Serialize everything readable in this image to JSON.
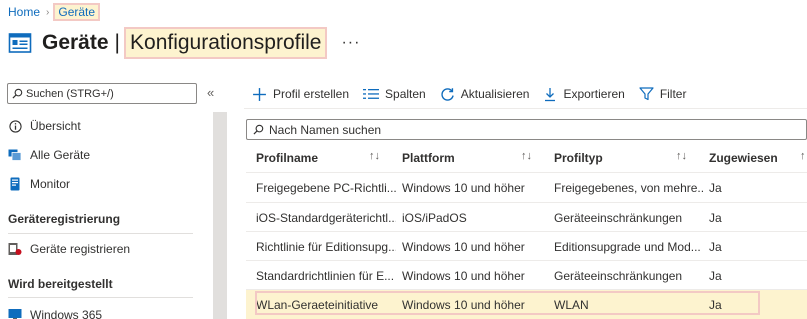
{
  "breadcrumb": {
    "home": "Home",
    "current": "Geräte"
  },
  "title": {
    "main": "Geräte",
    "separator": "|",
    "sub": "Konfigurationsprofile",
    "more": "···"
  },
  "sidebar": {
    "search_placeholder": "Suchen (STRG+/)",
    "collapse": "«",
    "items": [
      {
        "label": "Übersicht",
        "icon": "info-icon"
      },
      {
        "label": "Alle Geräte",
        "icon": "devices-icon"
      },
      {
        "label": "Monitor",
        "icon": "monitor-icon"
      }
    ],
    "section1": "Geräteregistrierung",
    "section1_items": [
      {
        "label": "Geräte registrieren",
        "icon": "enroll-icon"
      }
    ],
    "section2": "Wird bereitgestellt",
    "section2_items": [
      {
        "label": "Windows 365",
        "icon": "windows365-icon"
      }
    ]
  },
  "toolbar": {
    "create": "Profil erstellen",
    "columns": "Spalten",
    "refresh": "Aktualisieren",
    "export": "Exportieren",
    "filter": "Filter"
  },
  "filter_input": {
    "placeholder": "Nach Namen suchen"
  },
  "table": {
    "headers": [
      "Profilname",
      "Plattform",
      "Profiltyp",
      "Zugewiesen"
    ],
    "rows": [
      [
        "Freigegebene PC-Richtli...",
        "Windows 10 und höher",
        "Freigegebenes, von mehre...",
        "Ja"
      ],
      [
        "iOS-Standardgeräterichtl...",
        "iOS/iPadOS",
        "Geräteeinschränkungen",
        "Ja"
      ],
      [
        "Richtlinie für Editionsupg...",
        "Windows 10 und höher",
        "Editionsupgrade und Mod...",
        "Ja"
      ],
      [
        "Standardrichtlinien für E...",
        "Windows 10 und höher",
        "Geräteeinschränkungen",
        "Ja"
      ],
      [
        "WLan-Geraeteinitiative",
        "Windows 10 und höher",
        "WLAN",
        "Ja"
      ]
    ],
    "selected_row": 4
  },
  "colors": {
    "accent": "#0f6cbd",
    "highlight": "#fdf3cf",
    "highlight_border": "#f3c9c4"
  }
}
